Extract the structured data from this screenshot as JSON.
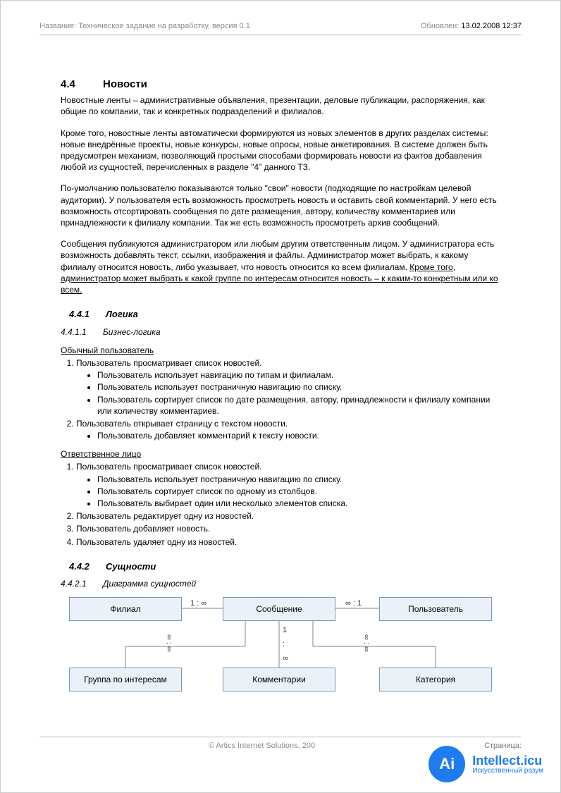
{
  "header": {
    "title_label": "Название:",
    "title_value": "Техническое задание на разработку, версия 0.1",
    "updated_label": "Обновлен:",
    "updated_value": "13.02.2008 12:37"
  },
  "section": {
    "number": "4.4",
    "title": "Новости",
    "paragraphs": [
      "Новостные ленты – административные объявления, презентации, деловые публикации, распоряжения, как общие по компании, так и конкретных подразделений и филиалов.",
      "Кроме того, новостные ленты автоматически формируются из новых элементов в других разделах системы: новые внедрённые проекты, новые конкурсы, новые опросы, новые анкетирования. В системе должен быть предусмотрен механизм, позволяющий простыми способами формировать новости из фактов добавления любой из сущностей, перечисленных в разделе \"4\" данного ТЗ.",
      "По-умолчанию пользователю показываются только \"свои\" новости (подходящие по настройкам целевой аудитории). У пользователя есть возможность просмотреть новость и оставить свой комментарий. У него есть возможность отсортировать сообщения по дате размещения, автору, количеству комментариев или принадлежности к филиалу компании. Так же есть возможность просмотреть архив сообщений."
    ],
    "p4_main": "Сообщения публикуются администратором или любым другим ответственным лицом. У администратора есть возможность добавлять текст, ссылки, изображения и файлы. Администратор может выбрать, к какому филиалу относится новость, либо указывает, что новость относится ко всем филиалам. ",
    "p4_under": "Кроме того, администратор может выбрать к какой группе по интересам относится новость – к каким-то конкретным или ко всем."
  },
  "logic": {
    "number": "4.4.1",
    "title": "Логика",
    "bl_number": "4.4.1.1",
    "bl_title": "Бизнес-логика",
    "role_user": "Обычный пользователь",
    "user_steps": [
      {
        "text": "Пользователь просматривает список новостей.",
        "sub": [
          "Пользователь использует навигацию по типам и филиалам.",
          "Пользователь использует постраничную навигацию по списку.",
          "Пользователь сортирует список по дате размещения, автору, принадлежности к филиалу компании или количеству комментариев."
        ]
      },
      {
        "text": "Пользователь открывает страницу с текстом новости.",
        "sub": [
          "Пользователь добавляет комментарий к тексту новости."
        ]
      }
    ],
    "role_admin": "Ответственное лицо",
    "admin_steps": [
      {
        "text": "Пользователь просматривает список новостей.",
        "sub": [
          "Пользователь использует постраничную навигацию по списку.",
          "Пользователь сортирует список по одному из столбцов.",
          "Пользователь выбирает один или несколько элементов списка."
        ]
      },
      {
        "text": "Пользователь редактирует одну из новостей.",
        "sub": []
      },
      {
        "text": "Пользователь добавляет новость.",
        "sub": []
      },
      {
        "text": "Пользователь удаляет одну из новостей.",
        "sub": []
      }
    ]
  },
  "entities": {
    "number": "4.4.2",
    "title": "Сущности",
    "diag_number": "4.4.2.1",
    "diag_title": "Диаграмма сущностей",
    "boxes": {
      "filial": "Филиал",
      "message": "Сообщение",
      "user": "Пользователь",
      "group": "Группа по интересам",
      "comments": "Комментарии",
      "category": "Категория"
    },
    "cards": {
      "fm": "1 : ∞",
      "mu": "∞ : 1",
      "mg": "∞ : ∞",
      "mc_top": "1",
      "mc_bot": "∞",
      "mk": "∞ : ∞"
    }
  },
  "footer": {
    "copyright": "© Artics Internet Solutions, 200",
    "page_label": "Страница:"
  },
  "watermark": {
    "glyph": "Ai",
    "line1": "Intellect.icu",
    "line2": "Искусственный разум"
  }
}
